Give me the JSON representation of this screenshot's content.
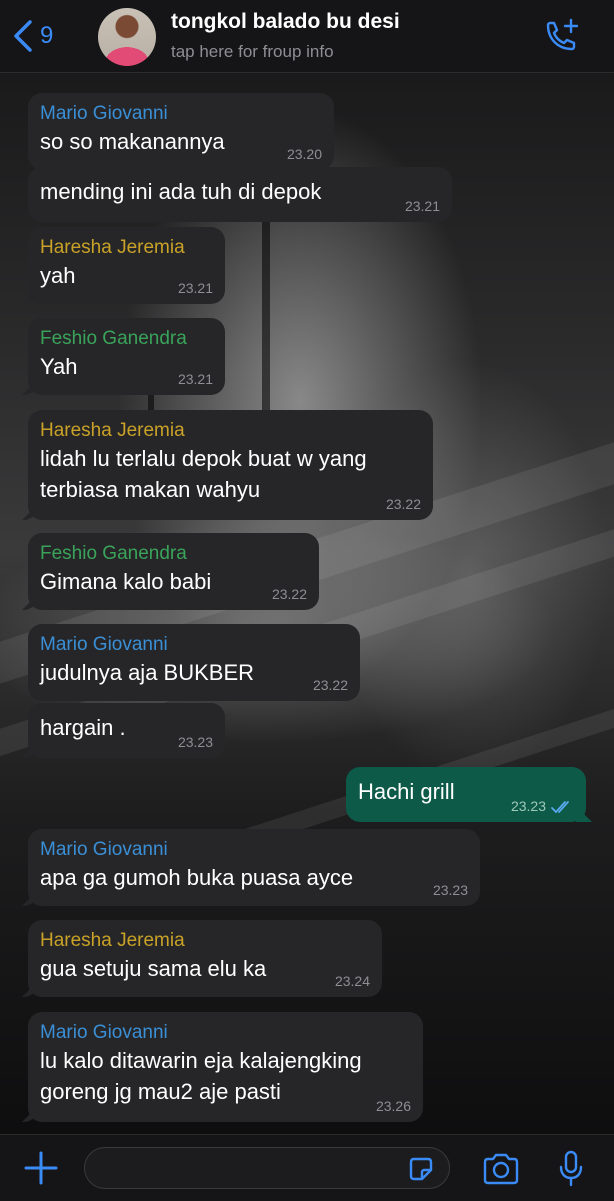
{
  "header": {
    "back_count": "9",
    "title": "tongkol balado bu desi",
    "subtitle": "tap here for froup info",
    "back_icon": "chevron-left-icon",
    "call_icon": "phone-plus-icon"
  },
  "colors": {
    "accent": "#3a8bf5",
    "mario": "#3a8fd6",
    "haresha": "#c9a227",
    "feshio": "#3aa35a",
    "incoming_bubble": "#262628",
    "outgoing_bubble": "#0c5a47"
  },
  "messages": [
    {
      "sender": "Mario Giovanni",
      "lines": [
        "so so makanannya"
      ],
      "time": "23.20"
    },
    {
      "sender": "",
      "lines": [
        "mending ini ada tuh di depok"
      ],
      "time": "23.21"
    },
    {
      "sender": "Haresha Jeremia",
      "lines": [
        "yah"
      ],
      "time": "23.21"
    },
    {
      "sender": "Feshio Ganendra",
      "lines": [
        "Yah"
      ],
      "time": "23.21"
    },
    {
      "sender": "Haresha Jeremia",
      "lines": [
        "lidah lu terlalu depok buat w yang",
        "terbiasa makan wahyu"
      ],
      "time": "23.22"
    },
    {
      "sender": "Feshio Ganendra",
      "lines": [
        "Gimana kalo babi"
      ],
      "time": "23.22"
    },
    {
      "sender": "Mario Giovanni",
      "lines": [
        "judulnya aja BUKBER"
      ],
      "time": "23.22"
    },
    {
      "sender": "",
      "lines": [
        "hargain ."
      ],
      "time": "23.23"
    },
    {
      "sender": "",
      "lines": [
        "Hachi grill"
      ],
      "time": "23.23",
      "outgoing": true
    },
    {
      "sender": "Mario Giovanni",
      "lines": [
        "apa ga gumoh buka puasa ayce"
      ],
      "time": "23.23"
    },
    {
      "sender": "Haresha Jeremia",
      "lines": [
        "gua setuju sama elu ka"
      ],
      "time": "23.24"
    },
    {
      "sender": "Mario Giovanni",
      "lines": [
        "lu kalo ditawarin eja kalajengking",
        "goreng jg mau2 aje pasti"
      ],
      "time": "23.26"
    }
  ],
  "composer": {
    "input_value": "",
    "input_placeholder": "",
    "plus_icon": "plus-icon",
    "sticker_icon": "sticker-icon",
    "camera_icon": "camera-icon",
    "mic_icon": "microphone-icon"
  }
}
